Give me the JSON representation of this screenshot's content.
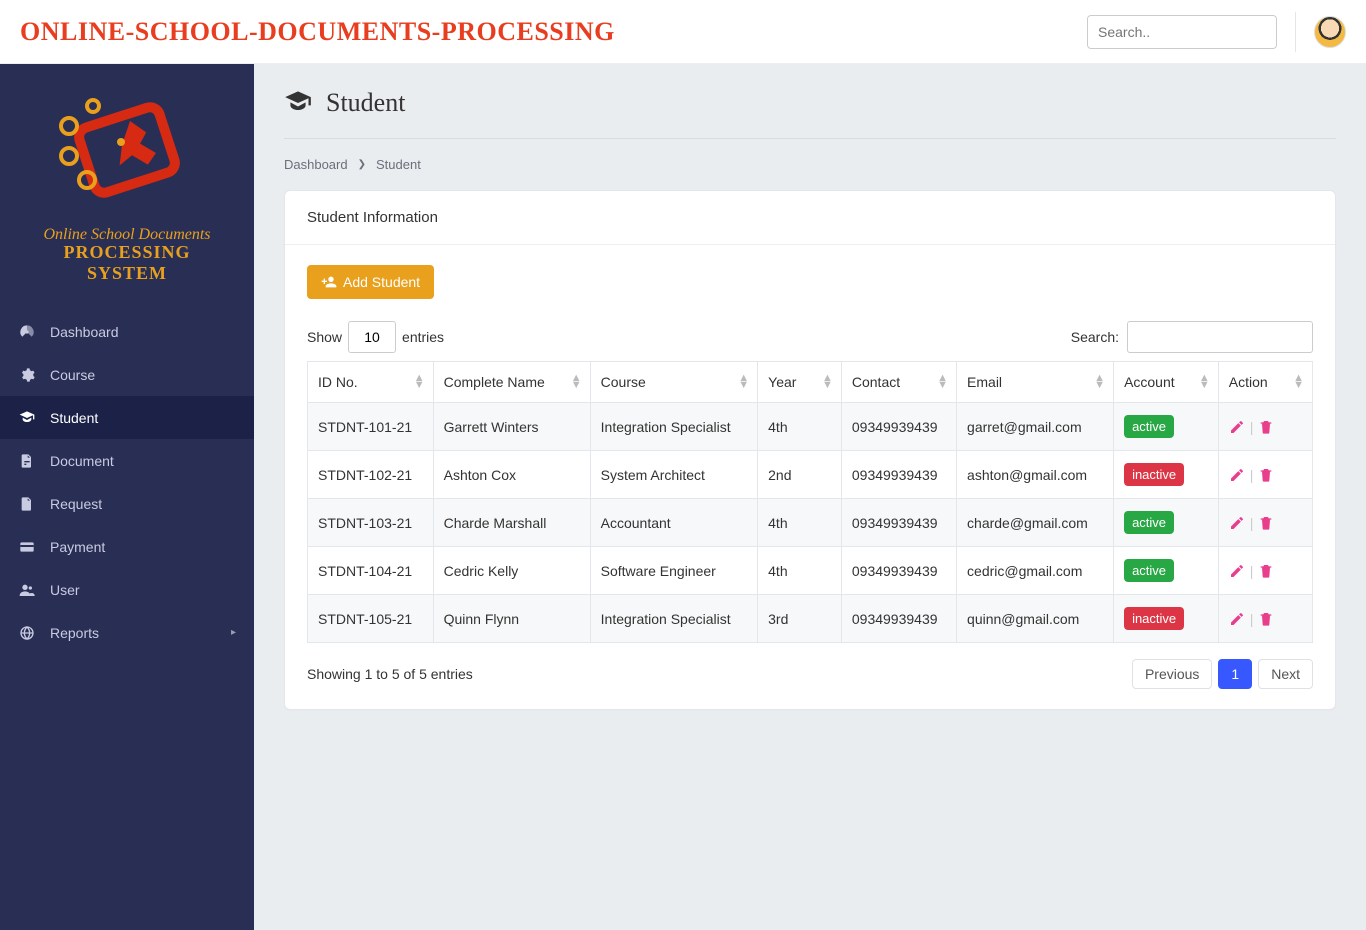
{
  "header": {
    "brand": "ONLINE-SCHOOL-DOCUMENTS-PROCESSING",
    "search_placeholder": "Search.."
  },
  "sidebar": {
    "logo_line1": "Online School Documents",
    "logo_line2": "PROCESSING SYSTEM",
    "items": [
      {
        "label": "Dashboard",
        "icon": "dashboard-icon",
        "active": false
      },
      {
        "label": "Course",
        "icon": "gear-icon",
        "active": false
      },
      {
        "label": "Student",
        "icon": "student-icon",
        "active": true
      },
      {
        "label": "Document",
        "icon": "document-icon",
        "active": false
      },
      {
        "label": "Request",
        "icon": "file-icon",
        "active": false
      },
      {
        "label": "Payment",
        "icon": "card-icon",
        "active": false
      },
      {
        "label": "User",
        "icon": "user-icon",
        "active": false
      },
      {
        "label": "Reports",
        "icon": "globe-icon",
        "active": false,
        "has_sub": true
      }
    ]
  },
  "page": {
    "title": "Student",
    "breadcrumb_prev": "Dashboard",
    "breadcrumb_current": "Student",
    "card_title": "Student Information",
    "add_button": "Add Student",
    "show_label_pre": "Show",
    "show_value": "10",
    "show_label_post": "entries",
    "search_label": "Search:",
    "columns": [
      "ID No.",
      "Complete Name",
      "Course",
      "Year",
      "Contact",
      "Email",
      "Account",
      "Action"
    ],
    "rows": [
      {
        "id": "STDNT-101-21",
        "name": "Garrett Winters",
        "course": "Integration Specialist",
        "year": "4th",
        "contact": "09349939439",
        "email": "garret@gmail.com",
        "account": "active"
      },
      {
        "id": "STDNT-102-21",
        "name": "Ashton Cox",
        "course": "System Architect",
        "year": "2nd",
        "contact": "09349939439",
        "email": "ashton@gmail.com",
        "account": "inactive"
      },
      {
        "id": "STDNT-103-21",
        "name": "Charde Marshall",
        "course": "Accountant",
        "year": "4th",
        "contact": "09349939439",
        "email": "charde@gmail.com",
        "account": "active"
      },
      {
        "id": "STDNT-104-21",
        "name": "Cedric Kelly",
        "course": "Software Engineer",
        "year": "4th",
        "contact": "09349939439",
        "email": "cedric@gmail.com",
        "account": "active"
      },
      {
        "id": "STDNT-105-21",
        "name": "Quinn Flynn",
        "course": "Integration Specialist",
        "year": "3rd",
        "contact": "09349939439",
        "email": "quinn@gmail.com",
        "account": "inactive"
      }
    ],
    "footer_info": "Showing 1 to 5 of 5 entries",
    "pager": {
      "prev": "Previous",
      "current": "1",
      "next": "Next"
    }
  }
}
